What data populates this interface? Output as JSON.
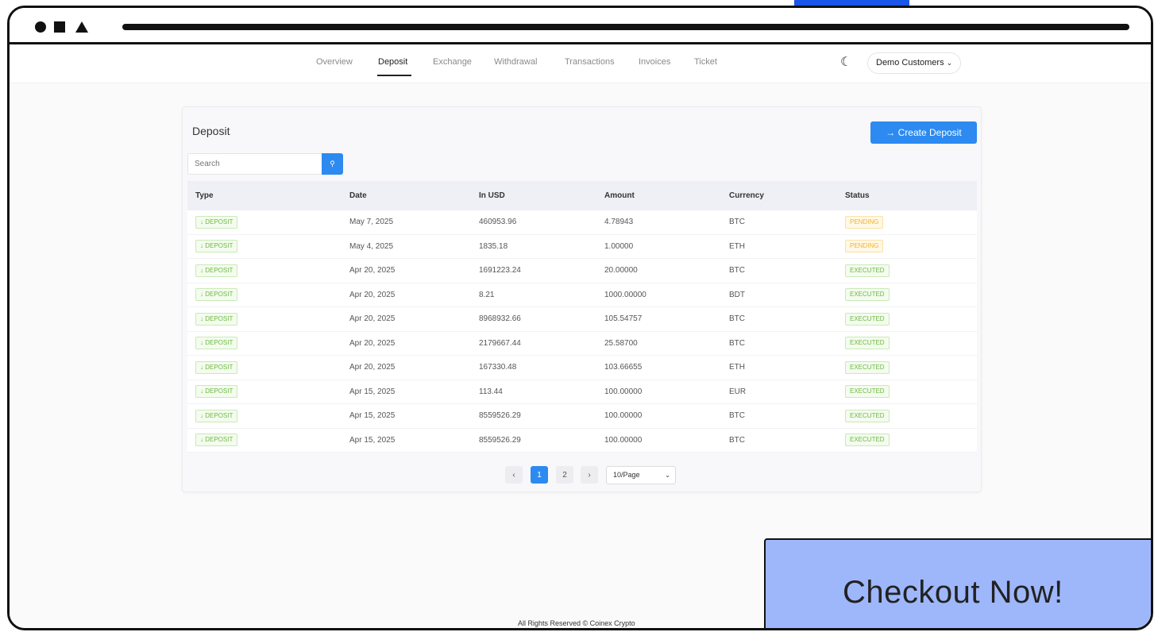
{
  "nav": {
    "items": [
      "Overview",
      "Deposit",
      "Exchange",
      "Withdrawal",
      "Transactions",
      "Invoices",
      "Ticket"
    ],
    "active": "Deposit",
    "user": "Demo Customers"
  },
  "card": {
    "title": "Deposit",
    "create_label": "Create Deposit",
    "search_placeholder": "Search"
  },
  "table": {
    "headers": [
      "Type",
      "Date",
      "In USD",
      "Amount",
      "Currency",
      "Status"
    ],
    "rows": [
      {
        "type": "DEPOSIT",
        "date": "May 7, 2025",
        "usd": "460953.96",
        "amount": "4.78943",
        "currency": "BTC",
        "status": "PENDING"
      },
      {
        "type": "DEPOSIT",
        "date": "May 4, 2025",
        "usd": "1835.18",
        "amount": "1.00000",
        "currency": "ETH",
        "status": "PENDING"
      },
      {
        "type": "DEPOSIT",
        "date": "Apr 20, 2025",
        "usd": "1691223.24",
        "amount": "20.00000",
        "currency": "BTC",
        "status": "EXECUTED"
      },
      {
        "type": "DEPOSIT",
        "date": "Apr 20, 2025",
        "usd": "8.21",
        "amount": "1000.00000",
        "currency": "BDT",
        "status": "EXECUTED"
      },
      {
        "type": "DEPOSIT",
        "date": "Apr 20, 2025",
        "usd": "8968932.66",
        "amount": "105.54757",
        "currency": "BTC",
        "status": "EXECUTED"
      },
      {
        "type": "DEPOSIT",
        "date": "Apr 20, 2025",
        "usd": "2179667.44",
        "amount": "25.58700",
        "currency": "BTC",
        "status": "EXECUTED"
      },
      {
        "type": "DEPOSIT",
        "date": "Apr 20, 2025",
        "usd": "167330.48",
        "amount": "103.66655",
        "currency": "ETH",
        "status": "EXECUTED"
      },
      {
        "type": "DEPOSIT",
        "date": "Apr 15, 2025",
        "usd": "113.44",
        "amount": "100.00000",
        "currency": "EUR",
        "status": "EXECUTED"
      },
      {
        "type": "DEPOSIT",
        "date": "Apr 15, 2025",
        "usd": "8559526.29",
        "amount": "100.00000",
        "currency": "BTC",
        "status": "EXECUTED"
      },
      {
        "type": "DEPOSIT",
        "date": "Apr 15, 2025",
        "usd": "8559526.29",
        "amount": "100.00000",
        "currency": "BTC",
        "status": "EXECUTED"
      }
    ]
  },
  "pagination": {
    "pages": [
      "1",
      "2"
    ],
    "current": "1",
    "per_page": "10/Page"
  },
  "footer": "All Rights Reserved © Coinex Crypto",
  "promo": "Checkout Now!",
  "colors": {
    "primary": "#2c8af0",
    "executed": "#6bbb3e",
    "pending": "#f0b43a",
    "promo_bg": "#9eb7fb"
  }
}
